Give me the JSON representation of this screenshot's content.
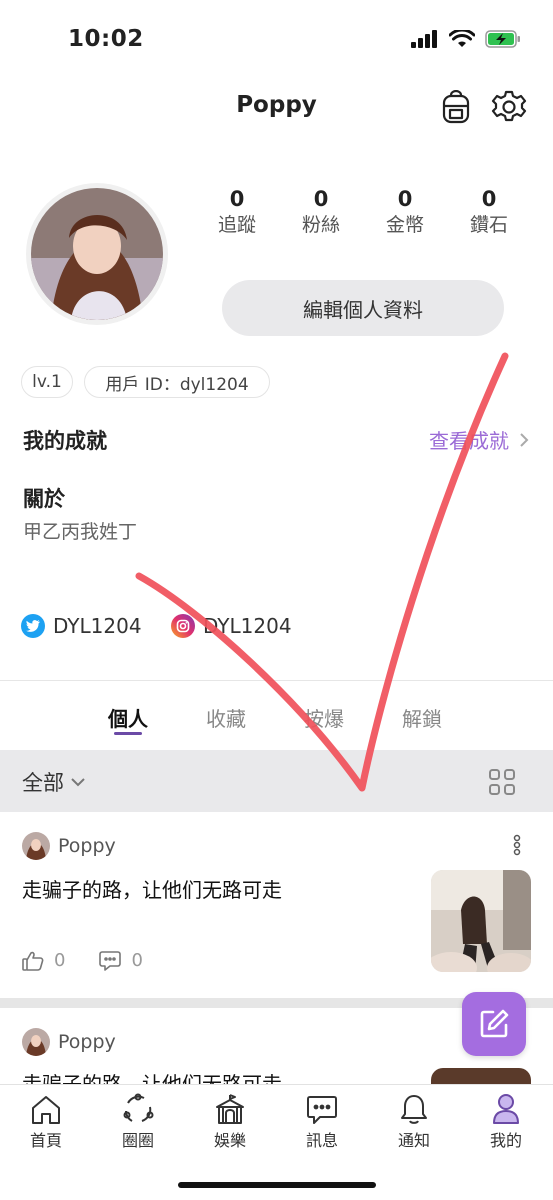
{
  "status_bar": {
    "time": "10:02"
  },
  "header": {
    "title": "Poppy",
    "backpack_icon": "backpack-icon",
    "settings_icon": "gear-icon"
  },
  "profile": {
    "stats": [
      {
        "value": "0",
        "label": "追蹤"
      },
      {
        "value": "0",
        "label": "粉絲"
      },
      {
        "value": "0",
        "label": "金幣"
      },
      {
        "value": "0",
        "label": "鑽石"
      }
    ],
    "edit_button": "編輯個人資料",
    "level_chip": "lv.1",
    "user_id_chip": "用戶 ID：dyl1204"
  },
  "achievements": {
    "title": "我的成就",
    "link": "查看成就"
  },
  "about": {
    "title": "關於",
    "text": "甲乙丙我姓丁"
  },
  "socials": [
    {
      "platform_icon": "twitter-icon",
      "handle": "DYL1204"
    },
    {
      "platform_icon": "instagram-icon",
      "handle": "DYL1204"
    }
  ],
  "tabs": [
    {
      "label": "個人",
      "active": true
    },
    {
      "label": "收藏",
      "active": false
    },
    {
      "label": "按爆",
      "active": false
    },
    {
      "label": "解鎖",
      "active": false
    }
  ],
  "filter": {
    "label": "全部",
    "layout_icon": "grid-icon"
  },
  "posts": [
    {
      "user": "Poppy",
      "text": "走骗子的路，让他们无路可走",
      "likes": "0",
      "comments": "0"
    },
    {
      "user": "Poppy",
      "text": "走骗子的路，让他们无路可走"
    }
  ],
  "bottom_nav": [
    {
      "label": "首頁",
      "icon": "home-icon"
    },
    {
      "label": "圈圈",
      "icon": "circle-icon"
    },
    {
      "label": "娛樂",
      "icon": "tent-icon"
    },
    {
      "label": "訊息",
      "icon": "message-icon"
    },
    {
      "label": "通知",
      "icon": "bell-icon"
    },
    {
      "label": "我的",
      "icon": "person-icon"
    }
  ],
  "colors": {
    "accent": "#9b6bd6",
    "tab_underline": "#6b4aa6",
    "fab": "#a46de0",
    "annotation": "#f0505a"
  }
}
